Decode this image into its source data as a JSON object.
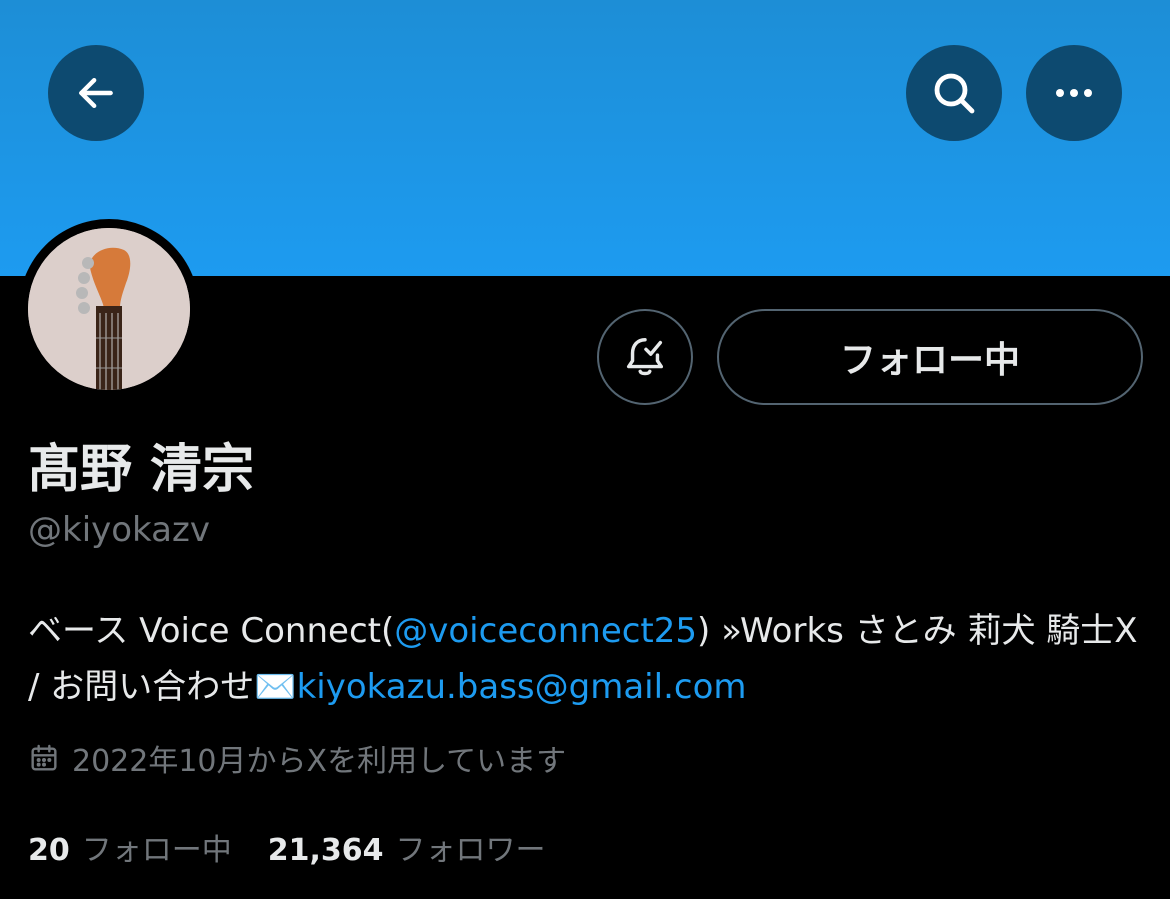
{
  "profile": {
    "display_name": "髙野 清宗",
    "handle": "@kiyokazv",
    "bio": {
      "part1": "ベース Voice Connect(",
      "mention": "@voiceconnect25",
      "part2": ") »Works さとみ 莉犬 騎士X / お問い合わせ",
      "email_emoji": "✉️",
      "email": "kiyokazu.bass@gmail.com"
    },
    "joined": "2022年10月からXを利用しています"
  },
  "actions": {
    "follow_label": "フォロー中",
    "icons": {
      "back": "arrow-left-icon",
      "search": "search-icon",
      "more": "more-horizontal-icon",
      "notify": "bell-check-icon",
      "calendar": "calendar-icon"
    }
  },
  "stats": {
    "following_count": "20",
    "following_label": "フォロー中",
    "followers_count": "21,364",
    "followers_label": "フォロワー"
  },
  "colors": {
    "banner": "#1d9bf0",
    "link": "#1d9bf0",
    "muted": "#71767b",
    "background": "#000000"
  }
}
